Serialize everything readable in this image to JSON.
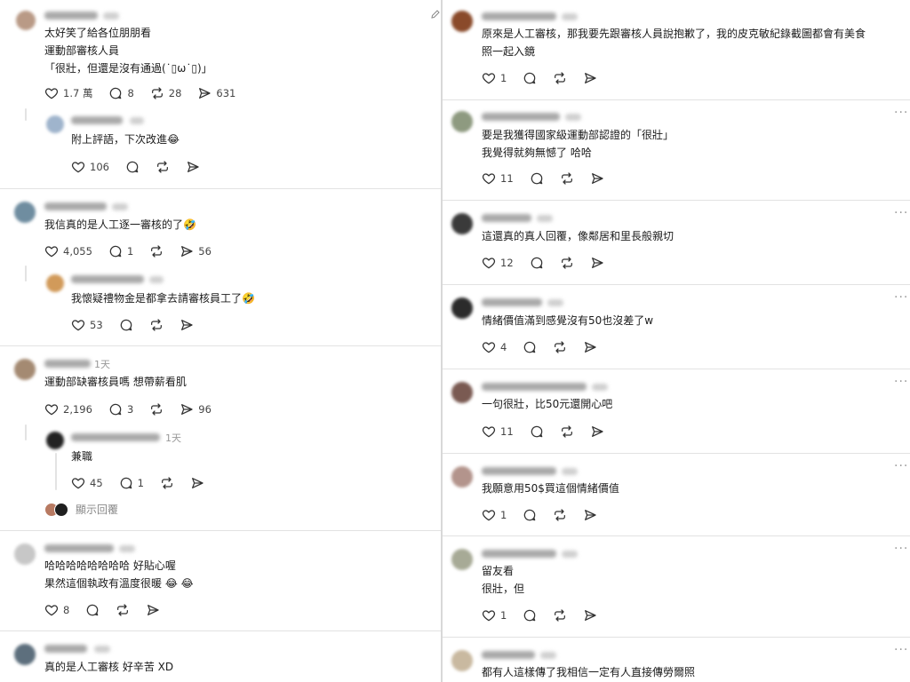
{
  "left": {
    "p1": {
      "text": "太好笑了給各位朋朋看\n運動部審核人員\n「很壯，但還是沒有通過(˙▯ω˙▯)」",
      "likes": "1.7 萬",
      "comments": "8",
      "reposts": "28",
      "shares": "631"
    },
    "r1": {
      "text": "附上評語，下次改進😂",
      "likes": "106"
    },
    "p2": {
      "text": "我信真的是人工逐一審核的了🤣",
      "likes": "4,055",
      "comments": "1",
      "shares": "56"
    },
    "r2": {
      "text": "我懷疑禮物金是都拿去請審核員工了🤣",
      "likes": "53"
    },
    "p3": {
      "time": "1天",
      "text": "運動部缺審核員嗎 想帶薪看肌",
      "likes": "2,196",
      "comments": "3",
      "shares": "96"
    },
    "r3": {
      "time": "1天",
      "text": "兼職",
      "likes": "45",
      "comments": "1"
    },
    "show_replies": "顯示回覆",
    "p4": {
      "text": "哈哈哈哈哈哈哈哈 好貼心喔\n果然這個執政有溫度很暖 😂 😂",
      "likes": "8"
    },
    "p5": {
      "text": "真的是人工審核 好辛苦 XD"
    }
  },
  "right": {
    "q1": {
      "text": "原來是人工審核，那我要先跟審核人員說抱歉了，我的皮克敏紀錄截圖都會有美食\n照一起入鏡",
      "likes": "1"
    },
    "q2": {
      "text": "要是我獲得國家級運動部認證的「很壯」\n我覺得就夠無憾了 哈哈",
      "likes": "11"
    },
    "q3": {
      "text": "這還真的真人回覆，像鄰居和里長般親切",
      "likes": "12"
    },
    "q4": {
      "text": "情緒價值滿到感覺沒有50也沒差了w",
      "likes": "4"
    },
    "q5": {
      "text": "一句很壯，比50元還開心吧",
      "likes": "11"
    },
    "q6": {
      "text": "我願意用50$買這個情緒價值",
      "likes": "1"
    },
    "q7": {
      "text": "留友看\n很壯，但",
      "likes": "1"
    },
    "q8": {
      "text": "都有人這樣傳了我相信一定有人直接傳勞爾照"
    }
  },
  "icons": [
    "heart-icon",
    "comment-icon",
    "repost-icon",
    "share-icon",
    "more-icon",
    "edit-icon"
  ],
  "colors": {
    "background": "#ffffff",
    "text": "#1b1b1b",
    "muted": "#888888",
    "divider": "#e2e2e2"
  }
}
